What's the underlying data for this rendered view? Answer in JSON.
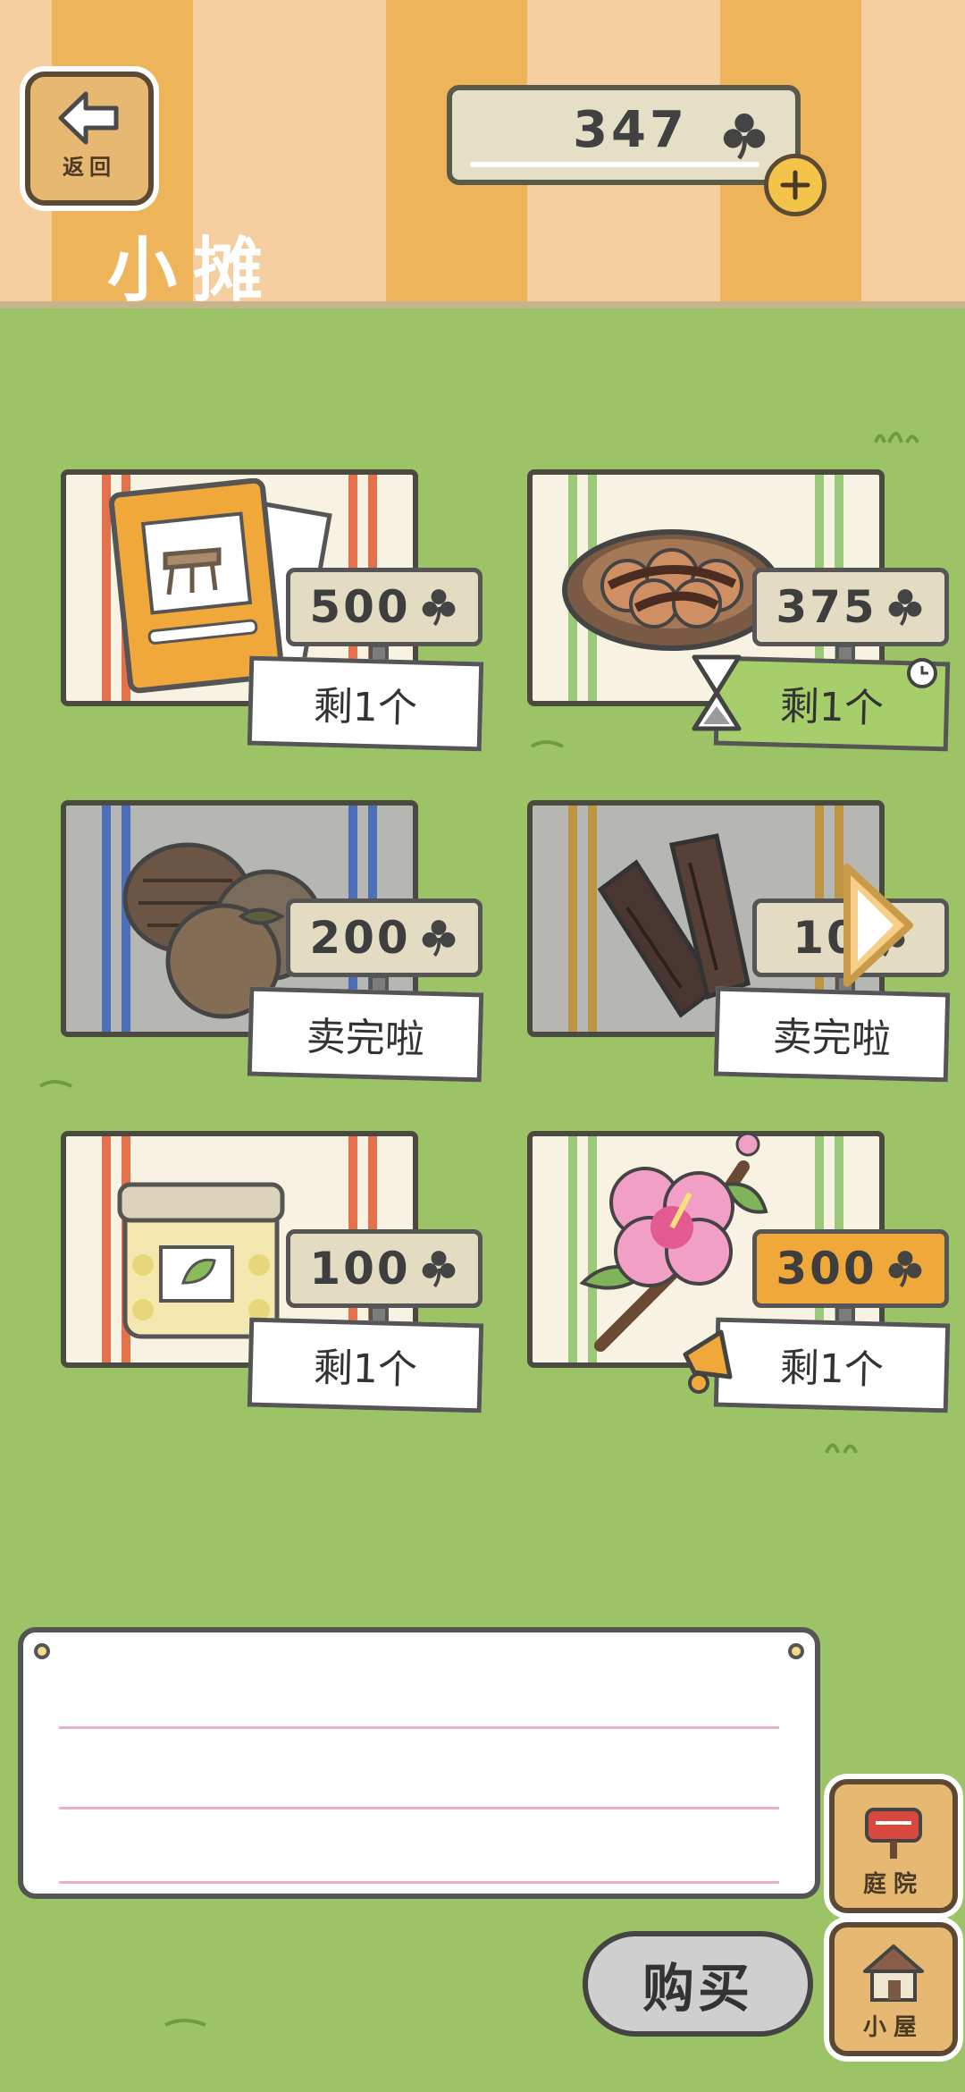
{
  "header": {
    "back_label": "返回",
    "title": "小摊",
    "clover_count": "347"
  },
  "items": [
    {
      "name": "picnic-table-catalog",
      "price": "500",
      "stock": "剩1个",
      "status": "available"
    },
    {
      "name": "dango-plate",
      "price": "375",
      "stock": "剩1个",
      "status": "limited-time"
    },
    {
      "name": "pinecone-and-nut",
      "price": "200",
      "stock": "卖完啦",
      "status": "sold-out"
    },
    {
      "name": "wood-logs",
      "price": "10",
      "stock": "卖完啦",
      "status": "sold-out"
    },
    {
      "name": "bean-jar",
      "price": "100",
      "stock": "剩1个",
      "status": "available"
    },
    {
      "name": "hibiscus-flower",
      "price": "300",
      "stock": "剩1个",
      "status": "featured"
    }
  ],
  "message_board": {
    "text": ""
  },
  "buttons": {
    "buy": "购买",
    "yard": "庭院",
    "house": "小屋"
  },
  "colors": {
    "grass": "#9cc466",
    "stripe_orange": "#edb45a",
    "stripe_light": "#f6cfa0",
    "price_tag_highlight": "#f0a83a",
    "stock_limited_green": "#a6cf6b"
  }
}
